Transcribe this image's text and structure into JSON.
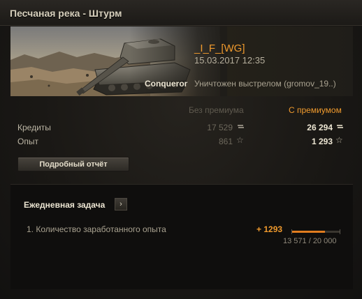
{
  "window": {
    "title": "Песчаная река - Штурм"
  },
  "battle": {
    "player": "_I_F_[WG]",
    "datetime": "15.03.2017 12:35",
    "vehicle": "Conqueror",
    "death_reason": "Уничтожен выстрелом (gromov_19..)"
  },
  "results": {
    "columns": {
      "no_premium": "Без премиума",
      "premium": "С премиумом"
    },
    "rows": [
      {
        "label": "Кредиты",
        "no_premium": "17 529",
        "premium": "26 294",
        "icon": "credits-icon"
      },
      {
        "label": "Опыт",
        "no_premium": "861",
        "premium": "1 293",
        "icon": "xp-star-icon"
      }
    ],
    "details_button": "Подробный отчёт"
  },
  "daily_task": {
    "title": "Ежедневная задача",
    "item": "1. Количество заработанного опыта",
    "gain": "+ 1293",
    "progress_text": "13 571 / 20 000",
    "progress_fraction": 0.679
  },
  "colors": {
    "accent": "#f09a2d",
    "text_bright": "#ece5d2",
    "text_dim": "#6d685c"
  }
}
